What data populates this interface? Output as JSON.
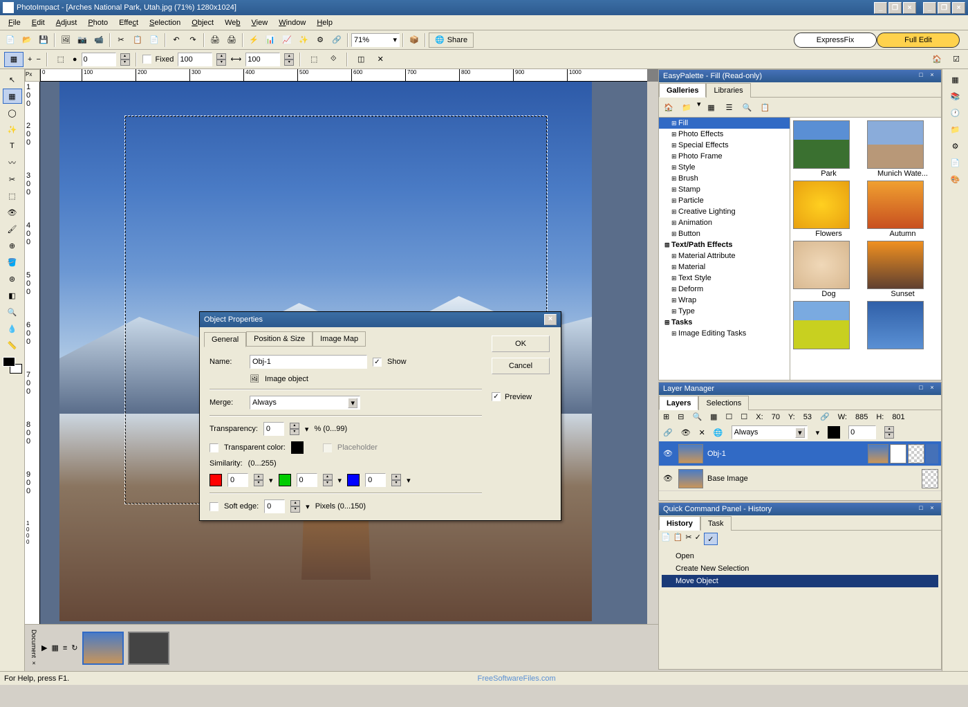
{
  "app": {
    "title": "PhotoImpact - [Arches National Park, Utah.jpg (71%) 1280x1024]"
  },
  "menu": [
    "File",
    "Edit",
    "Adjust",
    "Photo",
    "Effect",
    "Selection",
    "Object",
    "Web",
    "View",
    "Window",
    "Help"
  ],
  "toolbar": {
    "zoom": "71%",
    "share": "Share"
  },
  "modes": {
    "express": "ExpressFix",
    "full": "Full Edit"
  },
  "optbar": {
    "v1": "0",
    "fixed": "Fixed",
    "w": "100",
    "h": "100",
    "px": "Px"
  },
  "ruler_ticks": [
    "0",
    "100",
    "200",
    "300",
    "400",
    "500",
    "600",
    "700",
    "800",
    "900",
    "1000"
  ],
  "ruler_v_ticks": [
    "100",
    "200",
    "300",
    "400",
    "500",
    "600",
    "700",
    "800",
    "900",
    "1000"
  ],
  "dialog": {
    "title": "Object Properties",
    "tabs": [
      "General",
      "Position & Size",
      "Image Map"
    ],
    "name_label": "Name:",
    "name_value": "Obj-1",
    "show": "Show",
    "type": "Image object",
    "merge_label": "Merge:",
    "merge_value": "Always",
    "trans_label": "Transparency:",
    "trans_value": "0",
    "trans_range": "% (0...99)",
    "trans_color": "Transparent color:",
    "placeholder": "Placeholder",
    "sim_label": "Similarity:",
    "sim_range": "(0...255)",
    "r": "0",
    "g": "0",
    "b": "0",
    "soft_label": "Soft edge:",
    "soft_value": "0",
    "soft_range": "Pixels (0...150)",
    "ok": "OK",
    "cancel": "Cancel",
    "preview": "Preview"
  },
  "easypalette": {
    "title": "EasyPalette - Fill (Read-only)",
    "tabs": [
      "Galleries",
      "Libraries"
    ],
    "tree": [
      "Fill",
      "Photo Effects",
      "Special Effects",
      "Photo Frame",
      "Style",
      "Brush",
      "Stamp",
      "Particle",
      "Creative Lighting",
      "Animation",
      "Button"
    ],
    "tree_section2": "Text/Path Effects",
    "tree2": [
      "Material Attribute",
      "Material",
      "Text Style",
      "Deform",
      "Wrap",
      "Type"
    ],
    "tree_section3": "Tasks",
    "tree3": [
      "Image Editing Tasks"
    ],
    "thumbs": [
      "Park",
      "Munich Wate...",
      "Flowers",
      "Autumn",
      "Dog",
      "Sunset",
      "",
      ""
    ]
  },
  "layermgr": {
    "title": "Layer Manager",
    "tabs": [
      "Layers",
      "Selections"
    ],
    "x_label": "X:",
    "x": "70",
    "y_label": "Y:",
    "y": "53",
    "w_label": "W:",
    "w": "885",
    "h_label": "H:",
    "h": "801",
    "merge": "Always",
    "opacity": "0",
    "obj1": "Obj-1",
    "base": "Base Image"
  },
  "history": {
    "title": "Quick Command Panel - History",
    "tabs": [
      "History",
      "Task"
    ],
    "items": [
      "Open",
      "Create New Selection",
      "Move Object"
    ]
  },
  "status": "For Help, press F1.",
  "watermark": "FreeSoftwareFiles.com"
}
